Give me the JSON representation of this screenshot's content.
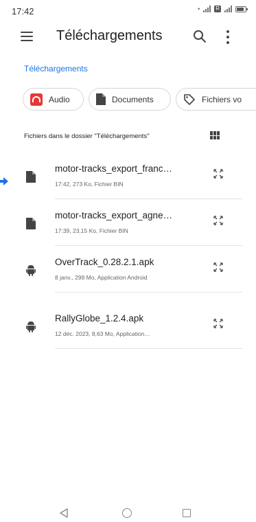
{
  "status_bar": {
    "time": "17:42"
  },
  "app_bar": {
    "title": "Téléchargements"
  },
  "breadcrumb": "Téléchargements",
  "chips": [
    {
      "label": "Audio",
      "icon": "headphones-icon",
      "color": "#e53935"
    },
    {
      "label": "Documents",
      "icon": "document-icon"
    },
    {
      "label": "Fichiers vo",
      "icon": "tag-icon"
    }
  ],
  "section": {
    "header": "Fichiers dans le dossier \"Téléchargements\""
  },
  "files": [
    {
      "name": "motor-tracks_export_franc…",
      "meta": "17:42, 273 Ko, Fichier BIN",
      "icon": "file-icon"
    },
    {
      "name": "motor-tracks_export_agne…",
      "meta": "17:39, 23,15 Ko, Fichier BIN",
      "icon": "file-icon"
    },
    {
      "name": "OverTrack_0.28.2.1.apk",
      "meta": "8 janv., 299 Mo, Application Android",
      "icon": "android-icon"
    },
    {
      "name": "RallyGlobe_1.2.4.apk",
      "meta": "12 déc. 2023, 8,63 Mo, Application…",
      "icon": "android-icon"
    }
  ],
  "colors": {
    "accent": "#1a73e8",
    "audio_chip": "#e53935",
    "pointer": "#1a73e8"
  }
}
